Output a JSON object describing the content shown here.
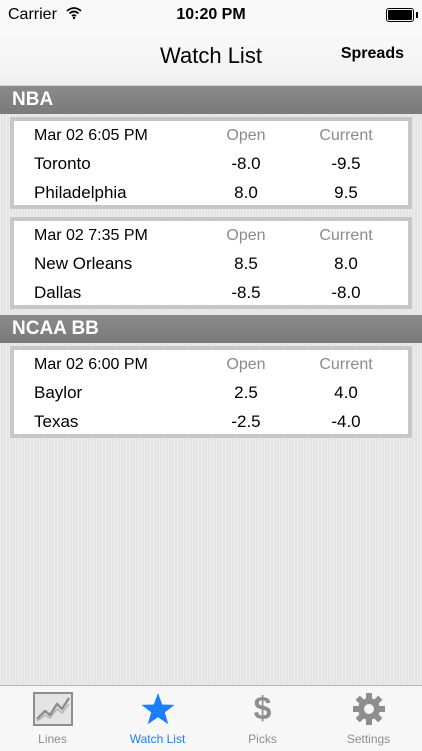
{
  "status_bar": {
    "carrier": "Carrier",
    "time": "10:20 PM"
  },
  "nav": {
    "title": "Watch List",
    "right_button": "Spreads"
  },
  "columns": {
    "open": "Open",
    "current": "Current"
  },
  "sections": [
    {
      "title": "NBA",
      "games": [
        {
          "date": "Mar 02 6:05 PM",
          "teams": [
            {
              "name": "Toronto",
              "open": "-8.0",
              "current": "-9.5"
            },
            {
              "name": "Philadelphia",
              "open": "8.0",
              "current": "9.5"
            }
          ]
        },
        {
          "date": "Mar 02 7:35 PM",
          "teams": [
            {
              "name": "New Orleans",
              "open": "8.5",
              "current": "8.0"
            },
            {
              "name": "Dallas",
              "open": "-8.5",
              "current": "-8.0"
            }
          ]
        }
      ]
    },
    {
      "title": "NCAA BB",
      "games": [
        {
          "date": "Mar 02 6:00 PM",
          "teams": [
            {
              "name": "Baylor",
              "open": "2.5",
              "current": "4.0"
            },
            {
              "name": "Texas",
              "open": "-2.5",
              "current": "-4.0"
            }
          ]
        }
      ]
    }
  ],
  "tabs": [
    {
      "label": "Lines",
      "icon": "chart-icon",
      "active": false
    },
    {
      "label": "Watch List",
      "icon": "star-icon",
      "active": true
    },
    {
      "label": "Picks",
      "icon": "dollar-icon",
      "active": false
    },
    {
      "label": "Settings",
      "icon": "gear-icon",
      "active": false
    }
  ],
  "colors": {
    "accent": "#1a7ffc",
    "section_header": "#808080",
    "card_border": "#c7c7c7",
    "inactive_tab": "#8e8e8e"
  }
}
